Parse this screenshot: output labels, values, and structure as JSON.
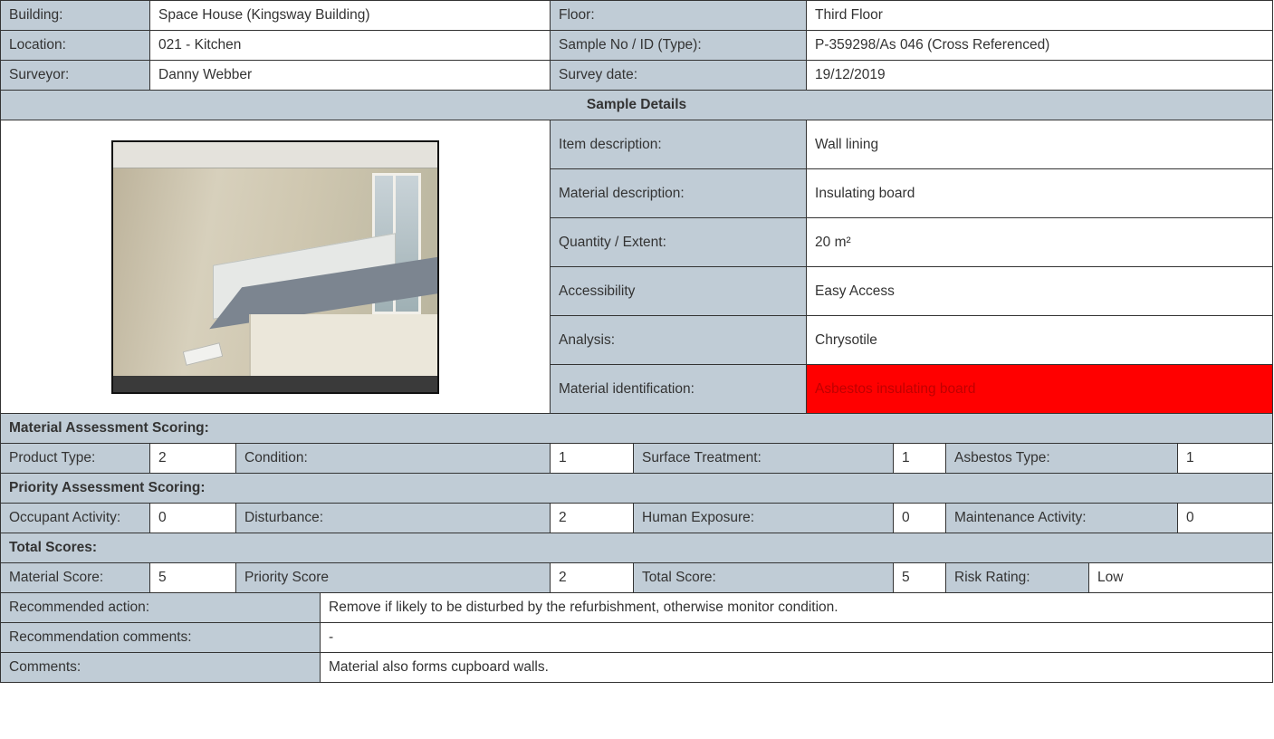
{
  "header": {
    "building_label": "Building:",
    "building": "Space House (Kingsway Building)",
    "floor_label": "Floor:",
    "floor": "Third Floor",
    "location_label": "Location:",
    "location": "021 - Kitchen",
    "sample_label": "Sample No / ID (Type):",
    "sample": "P-359298/As 046 (Cross Referenced)",
    "surveyor_label": "Surveyor:",
    "surveyor": "Danny Webber",
    "date_label": "Survey date:",
    "date": "19/12/2019"
  },
  "sample_details": {
    "title": "Sample Details",
    "item_label": "Item description:",
    "item": "Wall lining",
    "material_label": "Material description:",
    "material": "Insulating board",
    "quantity_label": "Quantity / Extent:",
    "quantity": "20 m²",
    "access_label": "Accessibility",
    "access": "Easy Access",
    "analysis_label": "Analysis:",
    "analysis": "Chrysotile",
    "ident_label": "Material identification:",
    "ident": "Asbestos insulating board",
    "ident_color": "#ff0000"
  },
  "material_assessment": {
    "title": "Material Assessment Scoring:",
    "product_type_label": "Product Type:",
    "product_type": "2",
    "condition_label": "Condition:",
    "condition": "1",
    "surface_label": "Surface Treatment:",
    "surface": "1",
    "asbestos_type_label": "Asbestos Type:",
    "asbestos_type": "1"
  },
  "priority_assessment": {
    "title": "Priority Assessment Scoring:",
    "occupant_label": "Occupant Activity:",
    "occupant": "0",
    "disturbance_label": "Disturbance:",
    "disturbance": "2",
    "exposure_label": "Human Exposure:",
    "exposure": "0",
    "maintenance_label": "Maintenance Activity:",
    "maintenance": "0"
  },
  "totals": {
    "title": "Total Scores:",
    "material_score_label": "Material Score:",
    "material_score": "5",
    "priority_score_label": "Priority Score",
    "priority_score": "2",
    "total_label": "Total Score:",
    "total": "5",
    "risk_label": "Risk Rating:",
    "risk": "Low"
  },
  "recommendations": {
    "action_label": "Recommended action:",
    "action": "Remove if likely to be disturbed by the refurbishment, otherwise monitor condition.",
    "comments_label": "Recommendation comments:",
    "comments": "-",
    "general_label": "Comments:",
    "general": "Material also forms cupboard walls."
  }
}
